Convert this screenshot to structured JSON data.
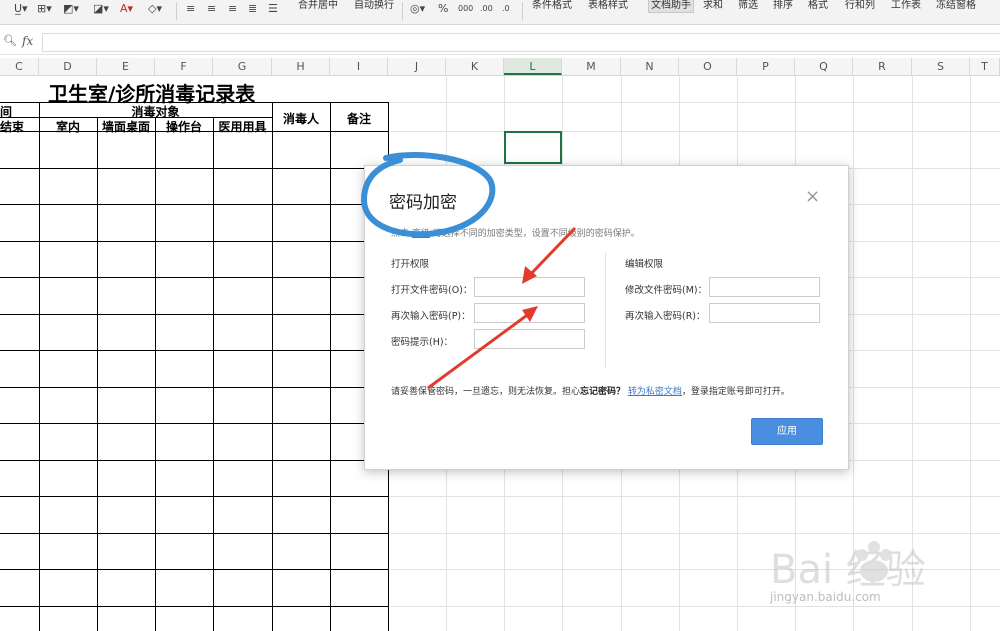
{
  "toolbar": {
    "groups": [
      "合并居中",
      "自动换行",
      "条件格式",
      "表格样式",
      "文档助手",
      "求和",
      "筛选",
      "排序",
      "格式",
      "行和列",
      "工作表",
      "冻结窗格"
    ],
    "percent": "%",
    "decimal_inc": ".00",
    "decimal_dec": ".0"
  },
  "formula_bar": {
    "fx_label": "fx",
    "value": ""
  },
  "columns": [
    "C",
    "D",
    "E",
    "F",
    "G",
    "H",
    "I",
    "J",
    "K",
    "L",
    "M",
    "N",
    "O",
    "P",
    "Q",
    "R",
    "S",
    "T"
  ],
  "selected_column": "L",
  "sheet": {
    "title": "卫生室/诊所消毒记录表",
    "header_time_fragment": "间",
    "header_end": "结束",
    "header_objects": "消毒对象",
    "sub_headers": [
      "室内",
      "墙面桌面",
      "操作台",
      "医用用具"
    ],
    "header_person": "消毒人",
    "header_note": "备注"
  },
  "dialog": {
    "title": "密码加密",
    "desc_prefix": "点击",
    "desc_link": "高级",
    "desc_suffix": "可选择不同的加密类型，设置不同级别的密码保护。",
    "open_section": "打开权限",
    "edit_section": "编辑权限",
    "open_password_label": "打开文件密码(O)：",
    "open_confirm_label": "再次输入密码(P)：",
    "hint_label": "密码提示(H)：",
    "edit_password_label": "修改文件密码(M)：",
    "edit_confirm_label": "再次输入密码(R)：",
    "note_prefix": "请妥善保管密码，一旦遗忘，则无法恢复。担心",
    "note_bold": "忘记密码？",
    "note_link": "转为私密文档",
    "note_suffix": "，登录指定账号即可打开。",
    "apply_label": "应用",
    "close_glyph": "×"
  },
  "watermark": {
    "brand": "Bai 经验",
    "url": "jingyan.baidu.com"
  },
  "colors": {
    "annotation_circle": "#3a8fd6",
    "arrow": "#e23b2e",
    "accent_green": "#217346",
    "apply_button": "#4a8ee0"
  }
}
